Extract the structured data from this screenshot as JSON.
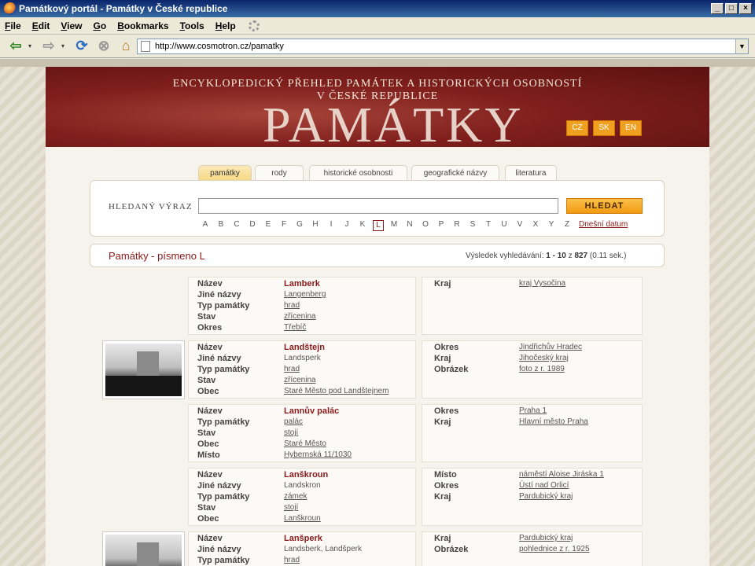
{
  "window": {
    "title": "Památkový portál - Památky v České republice",
    "controls": [
      "_",
      "□",
      "×"
    ]
  },
  "menu": [
    {
      "key": "F",
      "rest": "ile"
    },
    {
      "key": "E",
      "rest": "dit"
    },
    {
      "key": "V",
      "rest": "iew"
    },
    {
      "key": "G",
      "rest": "o"
    },
    {
      "key": "B",
      "rest": "ookmarks"
    },
    {
      "key": "T",
      "rest": "ools"
    },
    {
      "key": "H",
      "rest": "elp"
    }
  ],
  "toolbar": {
    "url": "http://www.cosmotron.cz/pamatky",
    "back_glyph": "⇦",
    "forward_glyph": "⇨",
    "reload_glyph": "⟳",
    "stop_glyph": "⊗",
    "home_glyph": "⌂",
    "dropdown_glyph": "▾",
    "url_dropdown_glyph": "▼"
  },
  "banner": {
    "subtitle_line1": "ENCYKLOPEDICKÝ PŘEHLED PAMÁTEK A HISTORICKÝCH OSOBNOSTÍ",
    "subtitle_line2": "V ČESKÉ REPUBLICE",
    "title": "PAMÁTKY",
    "languages": [
      "CZ",
      "SK",
      "EN"
    ]
  },
  "tabs": [
    {
      "label": "památky",
      "active": true
    },
    {
      "label": "rody",
      "active": false
    },
    {
      "label": "historické osobnosti",
      "active": false
    },
    {
      "label": "geografické názvy",
      "active": false
    },
    {
      "label": "literatura",
      "active": false
    }
  ],
  "search": {
    "label": "HLEDANÝ VÝRAZ",
    "value": "",
    "button": "HLEDAT",
    "alphabet": [
      "A",
      "B",
      "C",
      "D",
      "E",
      "F",
      "G",
      "H",
      "I",
      "J",
      "K",
      "L",
      "M",
      "N",
      "O",
      "P",
      "R",
      "S",
      "T",
      "U",
      "V",
      "X",
      "Y",
      "Z"
    ],
    "selected_letter": "L",
    "today_link": "Dnešní datum"
  },
  "results": {
    "title": "Památky - písmeno L",
    "info_prefix": "Výsledek vyhledávání:",
    "range": "1 - 10",
    "of_word": "z",
    "total": "827",
    "time": "(0.11 sek.)"
  },
  "records": [
    {
      "has_image": false,
      "left": [
        {
          "label": "Název",
          "value": "Lamberk",
          "link": false
        },
        {
          "label": "Jiné názvy",
          "value": "Langenberg",
          "link": true
        },
        {
          "label": "Typ památky",
          "value": "hrad",
          "link": true
        },
        {
          "label": "Stav",
          "value": "zřícenina",
          "link": true
        },
        {
          "label": "Okres",
          "value": "Třebíč",
          "link": true
        }
      ],
      "right": [
        {
          "label": "Kraj",
          "value": "kraj Vysočina",
          "link": true
        }
      ]
    },
    {
      "has_image": true,
      "left": [
        {
          "label": "Název",
          "value": "Landštejn",
          "link": false
        },
        {
          "label": "Jiné názvy",
          "value": "Landsperk",
          "link": false
        },
        {
          "label": "Typ památky",
          "value": "hrad",
          "link": true
        },
        {
          "label": "Stav",
          "value": "zřícenina",
          "link": true
        },
        {
          "label": "Obec",
          "value": "Staré Město pod Landštejnem",
          "link": true
        }
      ],
      "right": [
        {
          "label": "Okres",
          "value": "Jindřichův Hradec",
          "link": true
        },
        {
          "label": "Kraj",
          "value": "Jihočeský kraj",
          "link": true
        },
        {
          "label": "Obrázek",
          "value": "foto z r. 1989",
          "link": true
        }
      ]
    },
    {
      "has_image": false,
      "left": [
        {
          "label": "Název",
          "value": "Lannův palác",
          "link": false
        },
        {
          "label": "Typ památky",
          "value": "palác",
          "link": true
        },
        {
          "label": "Stav",
          "value": "stojí",
          "link": true
        },
        {
          "label": "Obec",
          "value": "Staré Město",
          "link": true
        },
        {
          "label": "Místo",
          "value": "Hybernská 11/1030",
          "link": true
        }
      ],
      "right": [
        {
          "label": "Okres",
          "value": "Praha 1",
          "link": true
        },
        {
          "label": "Kraj",
          "value": "Hlavní město Praha",
          "link": true
        }
      ]
    },
    {
      "has_image": false,
      "left": [
        {
          "label": "Název",
          "value": "Lanškroun",
          "link": false
        },
        {
          "label": "Jiné názvy",
          "value": "Landskron",
          "link": false
        },
        {
          "label": "Typ památky",
          "value": "zámek",
          "link": true
        },
        {
          "label": "Stav",
          "value": "stojí",
          "link": true
        },
        {
          "label": "Obec",
          "value": "Lanškroun",
          "link": true
        }
      ],
      "right": [
        {
          "label": "Místo",
          "value": "náměstí Aloise Jiráska 1",
          "link": true
        },
        {
          "label": "Okres",
          "value": "Ústí nad Orlicí",
          "link": true
        },
        {
          "label": "Kraj",
          "value": "Pardubický kraj",
          "link": true
        }
      ]
    },
    {
      "has_image": true,
      "left": [
        {
          "label": "Název",
          "value": "Lanšperk",
          "link": false
        },
        {
          "label": "Jiné názvy",
          "value": "Landsberk, Landšperk",
          "link": false
        },
        {
          "label": "Typ památky",
          "value": "hrad",
          "link": true
        }
      ],
      "right": [
        {
          "label": "Kraj",
          "value": "Pardubický kraj",
          "link": true
        },
        {
          "label": "Obrázek",
          "value": "pohlednice z r. 1925",
          "link": true
        }
      ]
    }
  ]
}
